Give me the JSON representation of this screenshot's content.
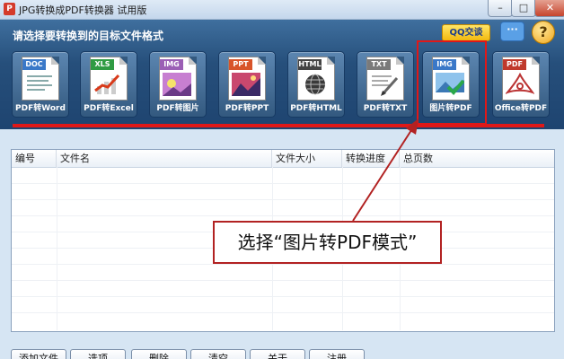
{
  "window": {
    "title": "JPG转换成PDF转换器 试用版",
    "app_icon_glyph": "P",
    "minimize": "–",
    "maximize": "□",
    "close": "✕"
  },
  "header": {
    "prompt": "请选择要转换到的目标文件格式",
    "qq_label": "QQ交谈",
    "chat_icon": "chat-bubble-icon",
    "chat_glyph": "···",
    "help_icon": "help-icon",
    "help_glyph": "?"
  },
  "formats": [
    {
      "tag": "DOC",
      "label": "PDF转Word",
      "tag_color": "#3a78c8",
      "icon": "word-doc-icon"
    },
    {
      "tag": "XLS",
      "label": "PDF转Excel",
      "tag_color": "#2f9b43",
      "icon": "excel-chart-icon"
    },
    {
      "tag": "IMG",
      "label": "PDF转图片",
      "tag_color": "#9b5fb5",
      "icon": "image-flower-icon"
    },
    {
      "tag": "PPT",
      "label": "PDF转PPT",
      "tag_color": "#d8542a",
      "icon": "ppt-slide-icon"
    },
    {
      "tag": "HTML",
      "label": "PDF转HTML",
      "tag_color": "#444444",
      "icon": "html-globe-icon"
    },
    {
      "tag": "TXT",
      "label": "PDF转TXT",
      "tag_color": "#7a7a7a",
      "icon": "txt-pen-icon"
    },
    {
      "tag": "IMG",
      "label": "图片转PDF",
      "tag_color": "#3a78c8",
      "icon": "image-to-pdf-check-icon"
    },
    {
      "tag": "PDF",
      "label": "Office转PDF",
      "tag_color": "#c0392b",
      "icon": "office-to-pdf-icon"
    }
  ],
  "table": {
    "columns": [
      "编号",
      "文件名",
      "文件大小",
      "转换进度",
      "总页数"
    ]
  },
  "buttons": [
    "添加文件",
    "选项",
    "删除",
    "清空",
    "关于",
    "注册"
  ],
  "annotation": {
    "text": "选择“图片转PDF模式”",
    "color": "#e01818"
  },
  "colors": {
    "header_blue": "#264f7b",
    "accent_red": "#e01818"
  }
}
